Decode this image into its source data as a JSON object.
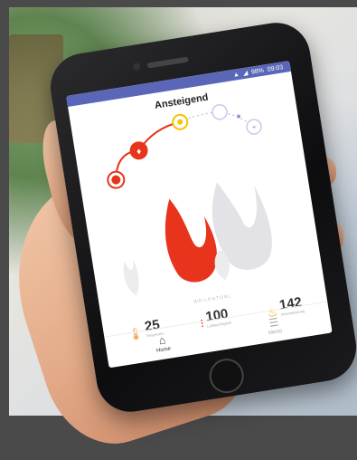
{
  "status_bar": {
    "battery": "98%",
    "time": "09:03"
  },
  "app": {
    "title": "Ansteigend"
  },
  "flame": {
    "label": "WEILENTONL"
  },
  "stats": [
    {
      "icon": "thermometer-icon",
      "value": "25",
      "label": "Temperatur"
    },
    {
      "icon": "level-dots-icon",
      "value": "100",
      "label": "Luftfeuchtigkeit"
    },
    {
      "icon": "flame-icon",
      "value": "142",
      "label": "Wärmeleistung"
    }
  ],
  "nav": {
    "home_label": "Home",
    "menu_label": "Menü"
  },
  "colors": {
    "accent": "#e8341c",
    "status_bar": "#5a67b8",
    "yellow": "#f5c400"
  }
}
